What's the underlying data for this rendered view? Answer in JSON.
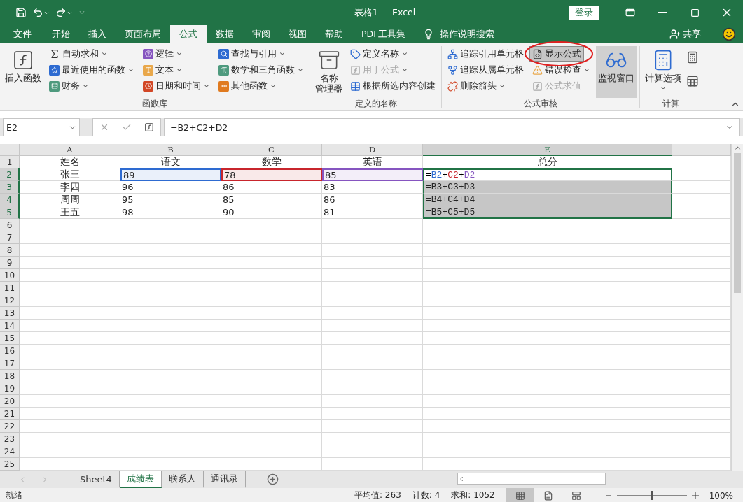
{
  "title_bar": {
    "title": "表格1  -  Excel",
    "sign_in": "登录"
  },
  "ribbon_tabs": [
    {
      "label": "文件",
      "selected": false
    },
    {
      "label": "开始",
      "selected": false
    },
    {
      "label": "插入",
      "selected": false
    },
    {
      "label": "页面布局",
      "selected": false
    },
    {
      "label": "公式",
      "selected": true
    },
    {
      "label": "数据",
      "selected": false
    },
    {
      "label": "审阅",
      "selected": false
    },
    {
      "label": "视图",
      "selected": false
    },
    {
      "label": "帮助",
      "selected": false
    },
    {
      "label": "PDF工具集",
      "selected": false
    }
  ],
  "tell_me": "操作说明搜索",
  "share": "共享",
  "ribbon_groups": [
    {
      "label": "函数库",
      "columns": [
        {
          "kind": "large",
          "lines": [
            "插入函数"
          ],
          "dropdown": false,
          "pressed": false
        },
        {
          "kind": "stack",
          "items": [
            {
              "label": "自动求和",
              "dropdown": true,
              "disabled": false,
              "pressed": false,
              "circled": false
            },
            {
              "label": "最近使用的函数",
              "dropdown": true,
              "disabled": false,
              "pressed": false,
              "circled": false
            },
            {
              "label": "财务",
              "dropdown": true,
              "disabled": false,
              "pressed": false,
              "circled": false
            }
          ]
        },
        {
          "kind": "stack",
          "items": [
            {
              "label": "逻辑",
              "dropdown": true,
              "disabled": false,
              "pressed": false,
              "circled": false
            },
            {
              "label": "文本",
              "dropdown": true,
              "disabled": false,
              "pressed": false,
              "circled": false
            },
            {
              "label": "日期和时间",
              "dropdown": true,
              "disabled": false,
              "pressed": false,
              "circled": false
            }
          ]
        },
        {
          "kind": "stack",
          "items": [
            {
              "label": "查找与引用",
              "dropdown": true,
              "disabled": false,
              "pressed": false,
              "circled": false
            },
            {
              "label": "数学和三角函数",
              "dropdown": true,
              "disabled": false,
              "pressed": false,
              "circled": false
            },
            {
              "label": "其他函数",
              "dropdown": true,
              "disabled": false,
              "pressed": false,
              "circled": false
            }
          ]
        }
      ]
    },
    {
      "label": "定义的名称",
      "columns": [
        {
          "kind": "large",
          "lines": [
            "名称",
            "管理器"
          ],
          "dropdown": false,
          "pressed": false
        },
        {
          "kind": "stack",
          "items": [
            {
              "label": "定义名称",
              "dropdown": true,
              "disabled": false,
              "pressed": false,
              "circled": false
            },
            {
              "label": "用于公式",
              "dropdown": true,
              "disabled": true,
              "pressed": false,
              "circled": false
            },
            {
              "label": "根据所选内容创建",
              "dropdown": false,
              "disabled": false,
              "pressed": false,
              "circled": false
            }
          ]
        }
      ]
    },
    {
      "label": "公式审核",
      "columns": [
        {
          "kind": "stack",
          "items": [
            {
              "label": "追踪引用单元格",
              "dropdown": false,
              "disabled": false,
              "pressed": false,
              "circled": false
            },
            {
              "label": "追踪从属单元格",
              "dropdown": false,
              "disabled": false,
              "pressed": false,
              "circled": false
            },
            {
              "label": "删除箭头",
              "dropdown": true,
              "disabled": false,
              "pressed": false,
              "circled": false
            }
          ]
        },
        {
          "kind": "stack",
          "items": [
            {
              "label": "显示公式",
              "dropdown": false,
              "disabled": false,
              "pressed": true,
              "circled": true
            },
            {
              "label": "错误检查",
              "dropdown": true,
              "disabled": false,
              "pressed": false,
              "circled": false
            },
            {
              "label": "公式求值",
              "dropdown": false,
              "disabled": true,
              "pressed": false,
              "circled": false
            }
          ]
        },
        {
          "kind": "large",
          "lines": [
            "监视窗口"
          ],
          "dropdown": false,
          "pressed": true
        }
      ]
    },
    {
      "label": "计算",
      "columns": [
        {
          "kind": "large",
          "lines": [
            "计算选项"
          ],
          "dropdown": true,
          "pressed": false
        },
        {
          "kind": "icons"
        }
      ]
    }
  ],
  "formula_bar": {
    "name_box": "E2",
    "formula": "=B2+C2+D2"
  },
  "columns": [
    {
      "label": "A",
      "selected": false
    },
    {
      "label": "B",
      "selected": false
    },
    {
      "label": "C",
      "selected": false
    },
    {
      "label": "D",
      "selected": false
    },
    {
      "label": "E",
      "selected": true
    }
  ],
  "rows": [
    {
      "number": "1",
      "selected": false,
      "cells": [
        {
          "kind": "label",
          "text": "姓名",
          "selected": false
        },
        {
          "kind": "label",
          "text": "语文",
          "selected": false
        },
        {
          "kind": "label",
          "text": "数学",
          "selected": false
        },
        {
          "kind": "label",
          "text": "英语",
          "selected": false
        },
        {
          "kind": "label",
          "text": "总分",
          "selected": false
        }
      ]
    },
    {
      "number": "2",
      "selected": true,
      "cells": [
        {
          "kind": "label",
          "text": "张三",
          "selected": false
        },
        {
          "kind": "value",
          "text": "89",
          "color": "#2e6bd1",
          "selected": false
        },
        {
          "kind": "value",
          "text": "78",
          "color": "#c8252c",
          "selected": false
        },
        {
          "kind": "value",
          "text": "85",
          "color": "#8655c0",
          "selected": false
        },
        {
          "kind": "formula",
          "selected": true,
          "active": true,
          "parts": [
            {
              "text": "="
            },
            {
              "text": "B2",
              "color": "#2e6bd1"
            },
            {
              "text": "+"
            },
            {
              "text": "C2",
              "color": "#c8252c"
            },
            {
              "text": "+"
            },
            {
              "text": "D2",
              "color": "#8655c0"
            }
          ]
        }
      ]
    },
    {
      "number": "3",
      "selected": true,
      "cells": [
        {
          "kind": "label",
          "text": "李四",
          "selected": false
        },
        {
          "kind": "value",
          "text": "96",
          "selected": false
        },
        {
          "kind": "value",
          "text": "86",
          "selected": false
        },
        {
          "kind": "value",
          "text": "83",
          "selected": false
        },
        {
          "kind": "formula",
          "text": "=B3+C3+D3",
          "selected": true,
          "active": false
        }
      ]
    },
    {
      "number": "4",
      "selected": true,
      "cells": [
        {
          "kind": "label",
          "text": "周周",
          "selected": false
        },
        {
          "kind": "value",
          "text": "95",
          "selected": false
        },
        {
          "kind": "value",
          "text": "85",
          "selected": false
        },
        {
          "kind": "value",
          "text": "86",
          "selected": false
        },
        {
          "kind": "formula",
          "text": "=B4+C4+D4",
          "selected": true,
          "active": false
        }
      ]
    },
    {
      "number": "5",
      "selected": true,
      "cells": [
        {
          "kind": "label",
          "text": "王五",
          "selected": false
        },
        {
          "kind": "value",
          "text": "98",
          "selected": false
        },
        {
          "kind": "value",
          "text": "90",
          "selected": false
        },
        {
          "kind": "value",
          "text": "81",
          "selected": false
        },
        {
          "kind": "formula",
          "text": "=B5+C5+D5",
          "selected": true,
          "active": false
        }
      ]
    },
    {
      "number": "6",
      "selected": false
    },
    {
      "number": "7",
      "selected": false
    },
    {
      "number": "8",
      "selected": false
    },
    {
      "number": "9",
      "selected": false
    },
    {
      "number": "10",
      "selected": false
    },
    {
      "number": "11",
      "selected": false
    },
    {
      "number": "12",
      "selected": false
    },
    {
      "number": "13",
      "selected": false
    },
    {
      "number": "14",
      "selected": false
    },
    {
      "number": "15",
      "selected": false
    },
    {
      "number": "16",
      "selected": false
    },
    {
      "number": "17",
      "selected": false
    },
    {
      "number": "18",
      "selected": false
    },
    {
      "number": "19",
      "selected": false
    },
    {
      "number": "20",
      "selected": false
    },
    {
      "number": "21",
      "selected": false
    },
    {
      "number": "22",
      "selected": false
    },
    {
      "number": "23",
      "selected": false
    },
    {
      "number": "24",
      "selected": false
    },
    {
      "number": "25",
      "selected": false
    }
  ],
  "sheet_tabs": [
    {
      "label": "Sheet4",
      "selected": false
    },
    {
      "label": "成绩表",
      "selected": true
    },
    {
      "label": "联系人",
      "selected": false
    },
    {
      "label": "通讯录",
      "selected": false
    }
  ],
  "status_bar": {
    "ready": "就绪",
    "average": "平均值: 263",
    "count": "计数: 4",
    "sum": "求和: 1052",
    "views": [
      {
        "kind": "normal",
        "selected": true
      },
      {
        "kind": "page_layout",
        "selected": false
      },
      {
        "kind": "page_break",
        "selected": false
      }
    ],
    "zoom": {
      "level": 0.5,
      "reading": "100%"
    }
  }
}
